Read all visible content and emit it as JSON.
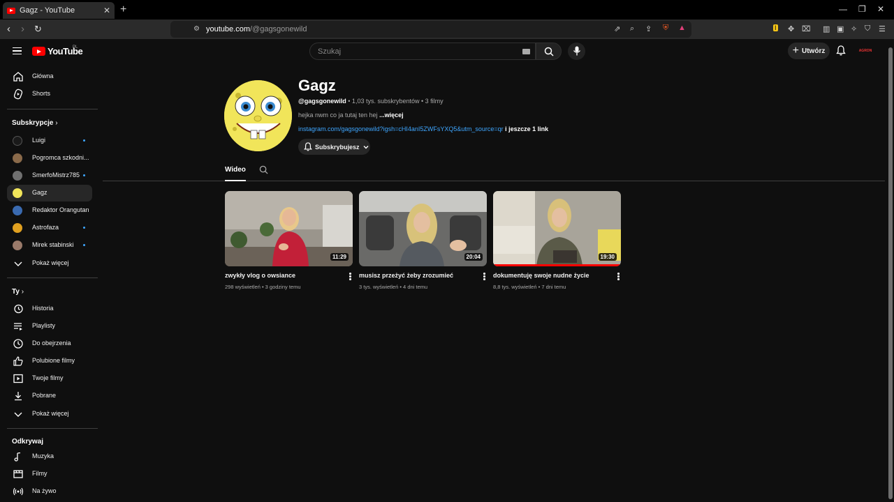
{
  "browser": {
    "tab_title": "Gagz - YouTube",
    "url_host": "youtube.com",
    "url_path": "/@gagsgonewild"
  },
  "header": {
    "logo_text": "YouTube",
    "country_code": "PL",
    "search_placeholder": "Szukaj",
    "create_label": "Utwórz",
    "avatar_text": "AGRON"
  },
  "sidebar": {
    "main": [
      {
        "label": "Główna",
        "icon": "home-icon"
      },
      {
        "label": "Shorts",
        "icon": "shorts-icon"
      }
    ],
    "subscriptions_heading": "Subskrypcje",
    "subscriptions": [
      {
        "label": "Luigi",
        "new": true,
        "color": "#1a1a1a"
      },
      {
        "label": "Pogromca szkodni...",
        "new": false,
        "color": "#8a6a4a"
      },
      {
        "label": "SmerfoMistrz785",
        "new": true,
        "color": "#707070"
      },
      {
        "label": "Gagz",
        "new": false,
        "color": "#f1e55a",
        "active": true
      },
      {
        "label": "Redaktor Orangutan",
        "new": false,
        "color": "#3a6ab0"
      },
      {
        "label": "Astrofaza",
        "new": true,
        "color": "#e0a020"
      },
      {
        "label": "Mirek stabinski",
        "new": true,
        "color": "#9a7a6a"
      }
    ],
    "show_more": "Pokaż więcej",
    "you_heading": "Ty",
    "you_items": [
      {
        "label": "Historia",
        "icon": "history-icon"
      },
      {
        "label": "Playlisty",
        "icon": "playlist-icon"
      },
      {
        "label": "Do obejrzenia",
        "icon": "watch-later-icon"
      },
      {
        "label": "Polubione filmy",
        "icon": "like-icon"
      },
      {
        "label": "Twoje filmy",
        "icon": "your-videos-icon"
      },
      {
        "label": "Pobrane",
        "icon": "download-icon"
      }
    ],
    "show_more_2": "Pokaż więcej",
    "explore_heading": "Odkrywaj",
    "explore_items": [
      {
        "label": "Muzyka",
        "icon": "music-icon"
      },
      {
        "label": "Filmy",
        "icon": "movies-icon"
      },
      {
        "label": "Na żywo",
        "icon": "live-icon"
      }
    ]
  },
  "channel": {
    "name": "Gagz",
    "handle": "@gagsgonewild",
    "stats": " • 1,03 tys. subskrybentów • 3 filmy",
    "description": "hejka nwm co ja tutaj ten hej ",
    "description_more": "...więcej",
    "link": "instagram.com/gagsgonewild?igsh=cHI4anI5ZWFsYXQ5&utm_source=qr",
    "link_more": " i jeszcze 1 link",
    "subscribe_label": "Subskrybujesz",
    "tab_videos": "Wideo"
  },
  "videos": [
    {
      "title": "zwykły vlog o owsiance",
      "meta": "298 wyświetleń • 3 godziny temu",
      "duration": "11:29",
      "progress": 0
    },
    {
      "title": "musisz przeżyć żeby zrozumieć",
      "meta": "3 tys. wyświetleń • 4 dni temu",
      "duration": "20:04",
      "progress": 0
    },
    {
      "title": "dokumentuję swoje nudne życie",
      "meta": "8,8 tys. wyświetleń • 7 dni temu",
      "duration": "19:30",
      "progress": 1.0
    }
  ]
}
